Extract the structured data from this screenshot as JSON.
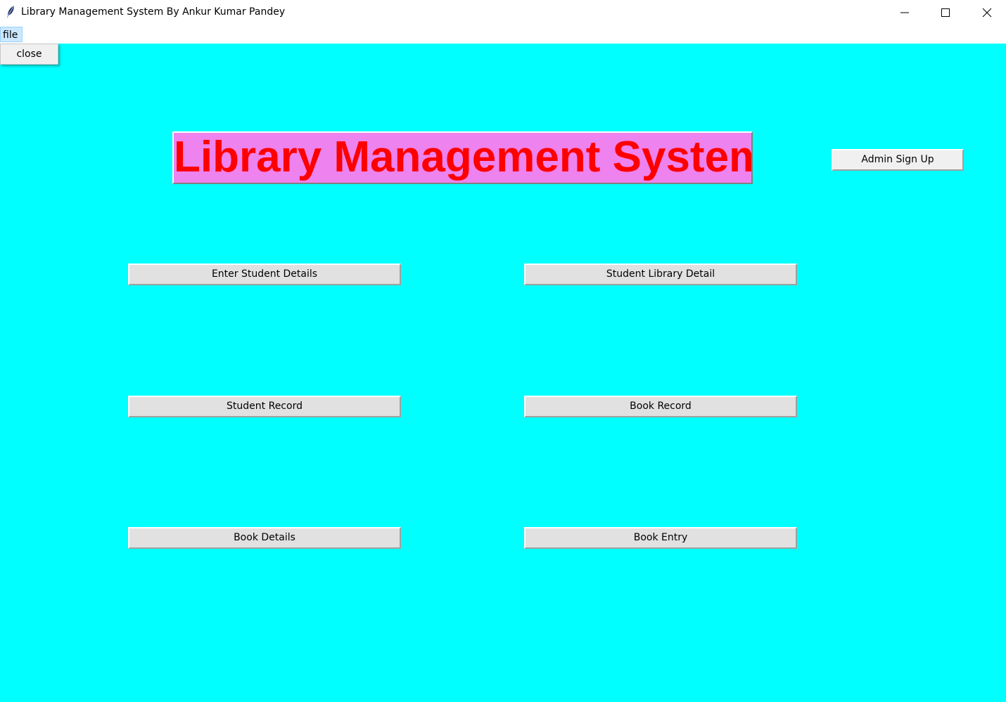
{
  "window": {
    "title": "Library Management System By Ankur Kumar Pandey",
    "icon": "feather-icon",
    "controls": [
      "minimize-icon",
      "maximize-icon",
      "close-icon"
    ]
  },
  "menubar": {
    "file_label": "file",
    "dropdown": {
      "items": [
        "close"
      ]
    }
  },
  "main": {
    "heading": "Library Management System",
    "admin_signup_label": "Admin Sign Up",
    "buttons": {
      "enter_student_details": "Enter Student Details",
      "student_library_detail": "Student Library Detail",
      "student_record": "Student Record",
      "book_record": "Book Record",
      "book_details": "Book Details",
      "book_entry": "Book Entry"
    }
  },
  "colors": {
    "background": "#00ffff",
    "heading_bg": "#ee82ee",
    "heading_text": "#ff0000",
    "button_bg": "#e1e1e1"
  }
}
